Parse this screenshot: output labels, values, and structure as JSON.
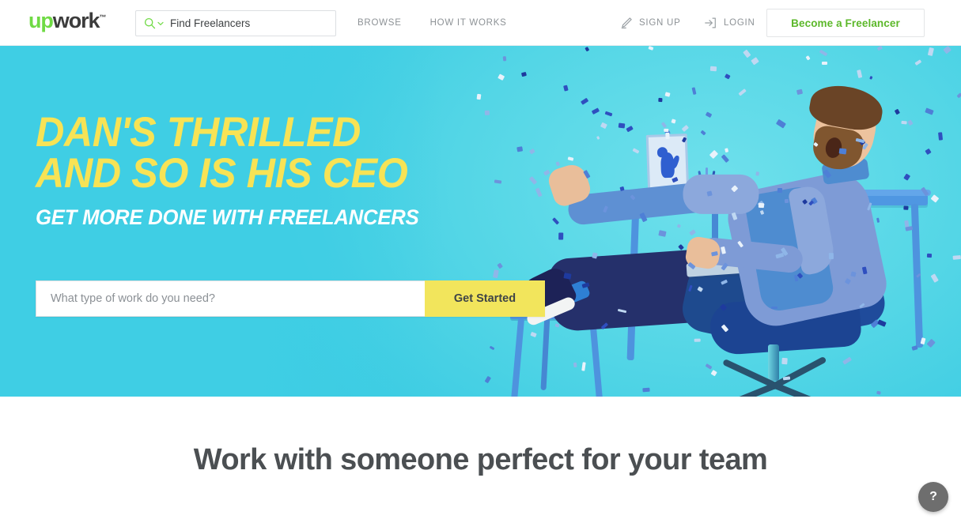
{
  "header": {
    "logo": {
      "part1": "up",
      "part2": "work",
      "tm": "™"
    },
    "search": {
      "icon": "search-icon",
      "chevron": "chevron-down-icon",
      "value": "Find Freelancers",
      "placeholder": "Find Freelancers"
    },
    "nav": [
      {
        "label": "BROWSE",
        "name": "browse"
      },
      {
        "label": "HOW IT WORKS",
        "name": "how-it-works"
      }
    ],
    "actions": [
      {
        "label": "SIGN UP",
        "icon": "pencil-icon",
        "name": "sign-up"
      },
      {
        "label": "LOGIN",
        "icon": "login-arrow-icon",
        "name": "login"
      }
    ],
    "cta_button": "Become a Freelancer"
  },
  "hero": {
    "headline_line1": "DAN'S THRILLED",
    "headline_line2": "AND SO IS HIS CEO",
    "subheadline": "GET MORE DONE WITH FREELANCERS",
    "search_placeholder": "What type of work do you need?",
    "search_value": "",
    "cta_button": "Get Started"
  },
  "section": {
    "title": "Work with someone perfect for your team"
  },
  "help": {
    "label": "?"
  },
  "colors": {
    "brand_green": "#6FDA44",
    "cta_green": "#5CB82A",
    "hero_cyan": "#3FCDE3",
    "headline_yellow": "#F7E355",
    "button_yellow": "#F2E55C",
    "dark_text": "#4B4F52",
    "muted_text": "#8D9296",
    "help_gray": "#6E6E6E"
  }
}
